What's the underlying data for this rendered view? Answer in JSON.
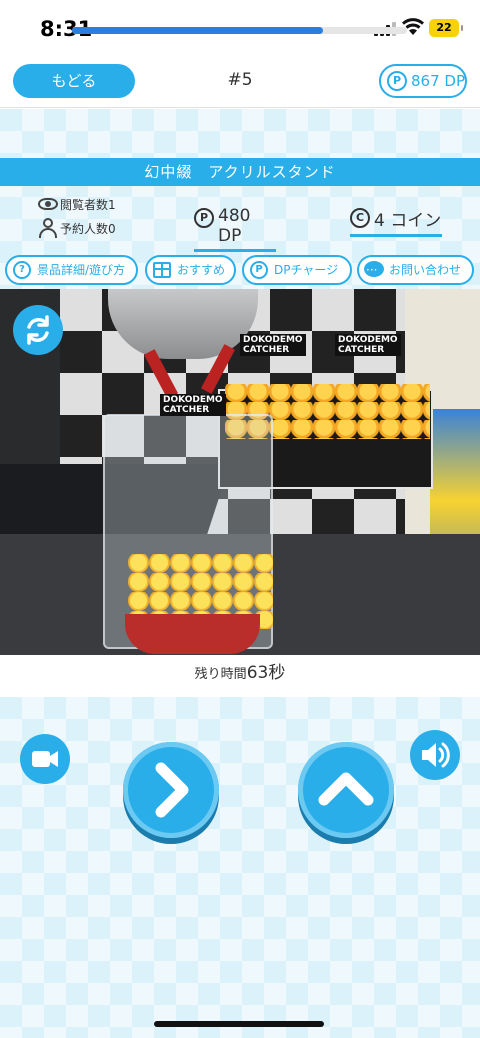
{
  "status_bar": {
    "time": "8:31",
    "battery": "22"
  },
  "nav": {
    "back_label": "もどる",
    "title": "#5",
    "dp_balance": "867 DP",
    "p_symbol": "P"
  },
  "prize": {
    "name": "幻中綴　アクリルスタンド",
    "viewers": "閲覧者数1",
    "reservations": "予約人数0",
    "price": "480 DP",
    "coins": "4 コイン",
    "coin_symbol": "C"
  },
  "actions": {
    "details": "景品詳細/遊び方",
    "recommend": "おすすめ",
    "dp_charge": "DPチャージ",
    "contact": "お問い合わせ",
    "help_symbol": "?"
  },
  "camera": {
    "brand_line1": "DOKODEMO",
    "brand_line2": "CATCHER"
  },
  "timer": {
    "label": "残り時間",
    "value": "63秒",
    "remaining_fraction": 0.75
  },
  "colors": {
    "accent": "#29aee9",
    "timer_fill": "#2a7fde",
    "pattern_bg": "#dcf2fb"
  },
  "icons": {
    "refresh": "refresh-icon",
    "video": "video-camera-icon",
    "sound": "speaker-icon",
    "right": "chevron-right-icon",
    "up": "chevron-up-icon"
  }
}
